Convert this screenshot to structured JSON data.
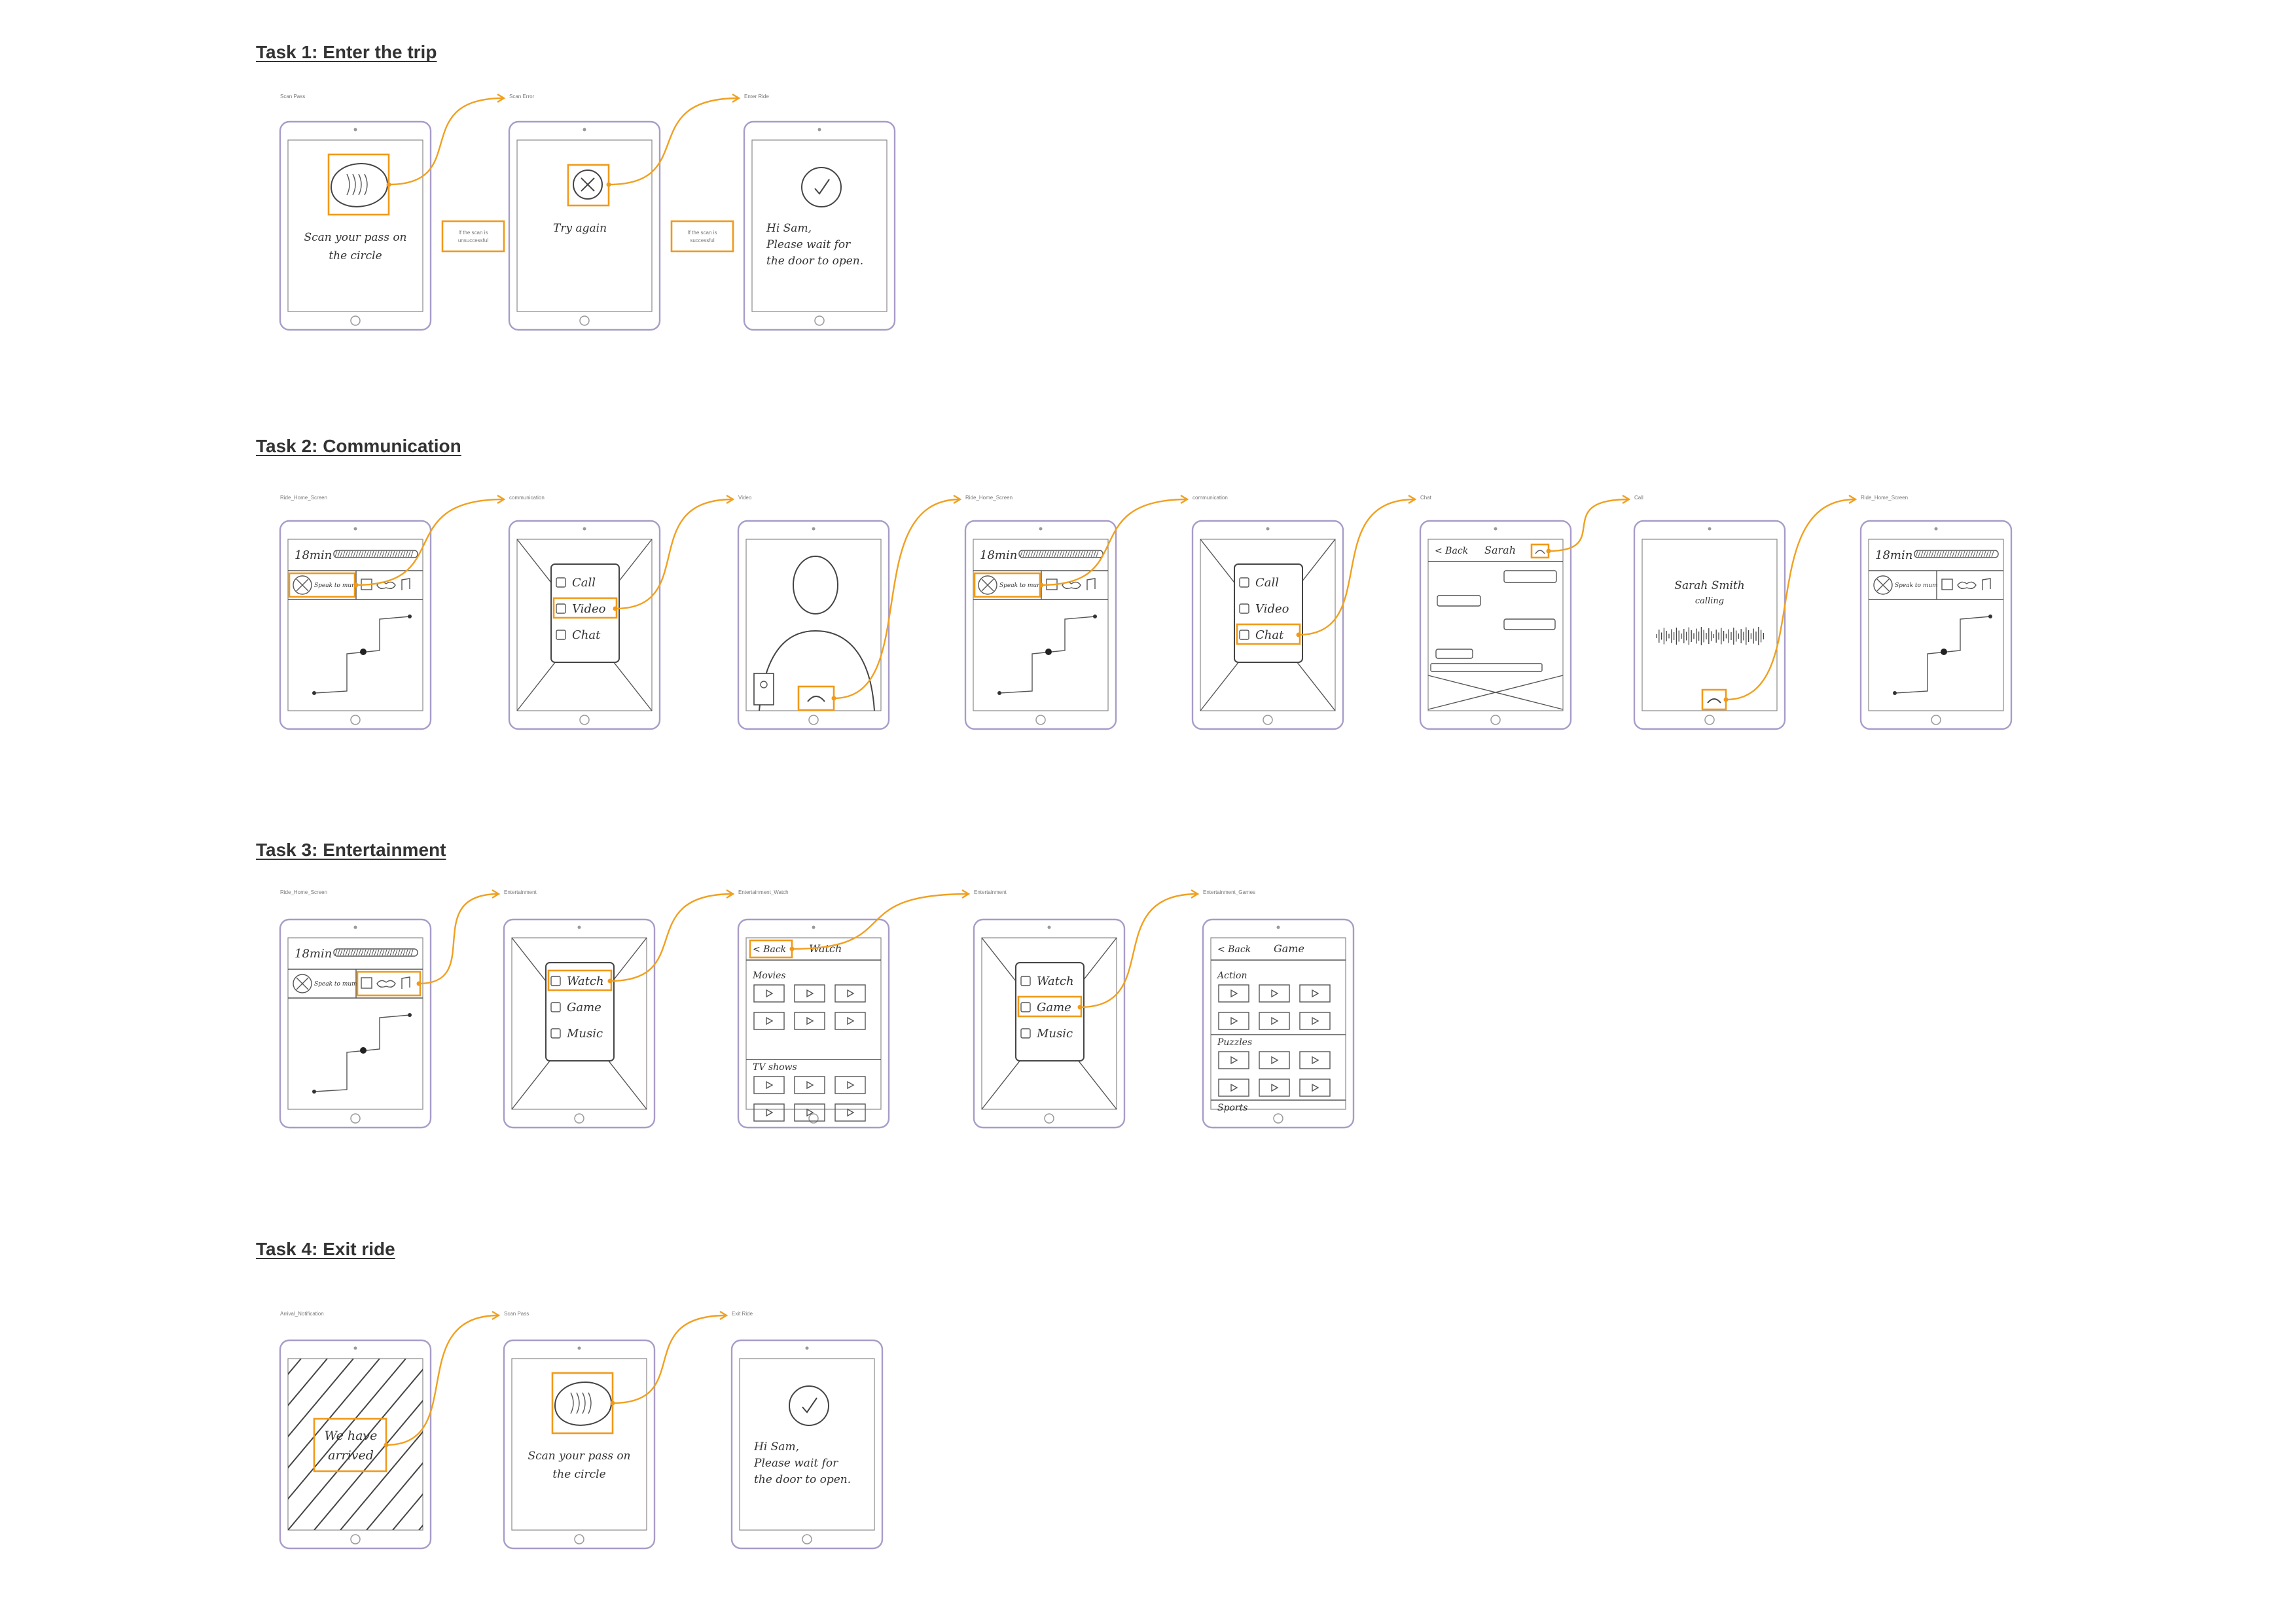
{
  "colors": {
    "highlight": "#f09a1a",
    "device_outline": "#a89cc8",
    "ink": "#444444",
    "heading": "#333333"
  },
  "tasks": [
    {
      "title": "Task 1: Enter the trip",
      "screens": [
        {
          "caption": "Scan Pass",
          "kind": "scan",
          "lines": [
            "Scan your pass on",
            "the circle"
          ]
        },
        {
          "caption": "Scan Error",
          "kind": "error",
          "lines": [
            "Try again"
          ]
        },
        {
          "caption": "Enter Ride",
          "kind": "success",
          "lines": [
            "Hi Sam,",
            "Please wait for",
            "the door to open."
          ]
        }
      ],
      "notes": [
        [
          "If the scan is",
          "unsuccessful"
        ],
        [
          "If the scan is",
          "successful"
        ]
      ]
    },
    {
      "title": "Task 2: Communication",
      "screens": [
        {
          "caption": "Ride_Home_Screen",
          "kind": "home",
          "time": "18min",
          "speak_label": "Speak to mum"
        },
        {
          "caption": "communication",
          "kind": "menu",
          "items": [
            "Call",
            "Video",
            "Chat"
          ]
        },
        {
          "caption": "Video",
          "kind": "video"
        },
        {
          "caption": "Ride_Home_Screen",
          "kind": "home",
          "time": "18min",
          "speak_label": "Speak to mum"
        },
        {
          "caption": "communication",
          "kind": "menu",
          "items": [
            "Call",
            "Video",
            "Chat"
          ]
        },
        {
          "caption": "Chat",
          "kind": "chat",
          "back": "< Back",
          "name": "Sarah"
        },
        {
          "caption": "Call",
          "kind": "call",
          "name": "Sarah Smith",
          "status": "calling"
        },
        {
          "caption": "Ride_Home_Screen",
          "kind": "home",
          "time": "18min",
          "speak_label": "Speak to mum"
        }
      ]
    },
    {
      "title": "Task 3: Entertainment",
      "screens": [
        {
          "caption": "Ride_Home_Screen",
          "kind": "home",
          "time": "18min",
          "speak_label": "Speak to mum"
        },
        {
          "caption": "Entertainment",
          "kind": "menu",
          "items": [
            "Watch",
            "Game",
            "Music"
          ]
        },
        {
          "caption": "Entertainment_Watch",
          "kind": "grid",
          "back": "< Back",
          "header": "Watch",
          "sections": [
            "Movies",
            "TV shows"
          ]
        },
        {
          "caption": "Entertainment",
          "kind": "menu",
          "items": [
            "Watch",
            "Game",
            "Music"
          ]
        },
        {
          "caption": "Entertainment_Games",
          "kind": "grid",
          "back": "< Back",
          "header": "Game",
          "sections": [
            "Action",
            "Puzzles",
            "Sports"
          ]
        }
      ]
    },
    {
      "title": "Task 4: Exit ride",
      "screens": [
        {
          "caption": "Arrival_Notification",
          "kind": "arrival",
          "lines": [
            "We have",
            "arrived"
          ]
        },
        {
          "caption": "Scan Pass",
          "kind": "scan",
          "lines": [
            "Scan your pass on",
            "the circle"
          ]
        },
        {
          "caption": "Exit Ride",
          "kind": "success",
          "lines": [
            "Hi Sam,",
            "Please wait for",
            "the door to open."
          ]
        }
      ]
    }
  ]
}
